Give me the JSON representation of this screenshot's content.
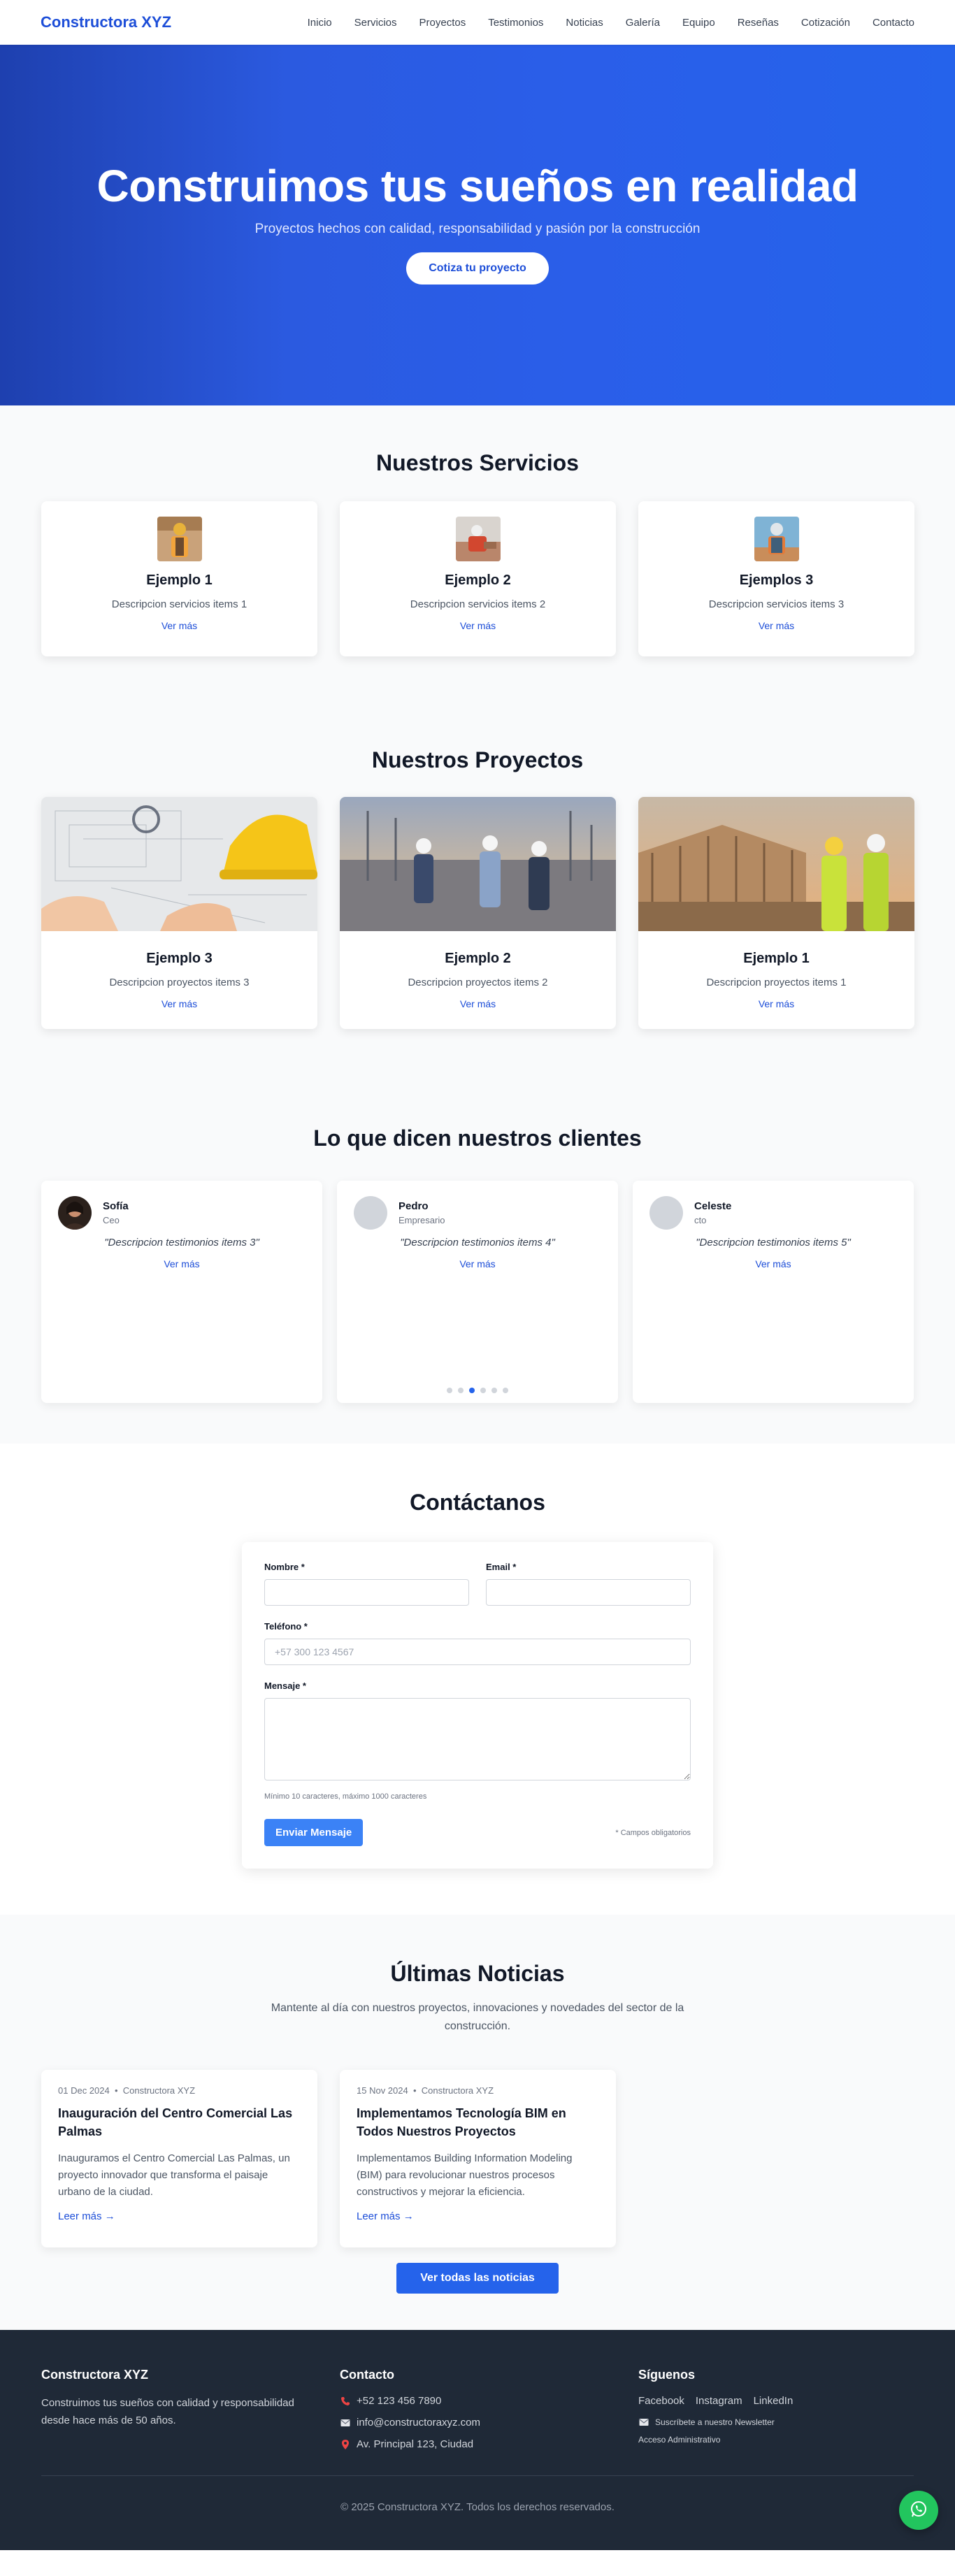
{
  "nav": {
    "brand": "Constructora XYZ",
    "links": [
      "Inicio",
      "Servicios",
      "Proyectos",
      "Testimonios",
      "Noticias",
      "Galería",
      "Equipo",
      "Reseñas",
      "Cotización",
      "Contacto"
    ]
  },
  "hero": {
    "title": "Construimos tus sueños en realidad",
    "subtitle": "Proyectos hechos con calidad, responsabilidad y pasión por la construcción",
    "cta": "Cotiza tu proyecto"
  },
  "services": {
    "title": "Nuestros Servicios",
    "items": [
      {
        "title": "Ejemplo 1",
        "desc": "Descripcion servicios items 1",
        "link": "Ver más"
      },
      {
        "title": "Ejemplo 2",
        "desc": "Descripcion servicios items 2",
        "link": "Ver más"
      },
      {
        "title": "Ejemplos 3",
        "desc": "Descripcion servicios items 3",
        "link": "Ver más"
      }
    ]
  },
  "projects": {
    "title": "Nuestros Proyectos",
    "items": [
      {
        "title": "Ejemplo 3",
        "desc": "Descripcion proyectos items 3",
        "link": "Ver más"
      },
      {
        "title": "Ejemplo 2",
        "desc": "Descripcion proyectos items 2",
        "link": "Ver más"
      },
      {
        "title": "Ejemplo 1",
        "desc": "Descripcion proyectos items 1",
        "link": "Ver más"
      }
    ]
  },
  "testimonials": {
    "title": "Lo que dicen nuestros clientes",
    "items": [
      {
        "name": "Sofía",
        "role": "Ceo",
        "quote": "\"Descripcion testimonios items 3\"",
        "link": "Ver más"
      },
      {
        "name": "Pedro",
        "role": "Empresario",
        "quote": "\"Descripcion testimonios items 4\"",
        "link": "Ver más"
      },
      {
        "name": "Celeste",
        "role": "cto",
        "quote": "\"Descripcion testimonios items 5\"",
        "link": "Ver más"
      }
    ],
    "active_dot": 2,
    "dot_count": 6
  },
  "contact": {
    "title": "Contáctanos",
    "name_label": "Nombre *",
    "email_label": "Email *",
    "phone_label": "Teléfono *",
    "phone_placeholder": "+57 300 123 4567",
    "message_label": "Mensaje *",
    "hint": "Mínimo 10 caracteres, máximo 1000 caracteres",
    "submit": "Enviar Mensaje",
    "required_note": "* Campos obligatorios"
  },
  "news": {
    "title": "Últimas Noticias",
    "subtitle": "Mantente al día con nuestros proyectos, innovaciones y novedades del sector de la construcción.",
    "items": [
      {
        "date": "01 Dec 2024",
        "source": "Constructora XYZ",
        "title": "Inauguración del Centro Comercial Las Palmas",
        "body": "Inauguramos el Centro Comercial Las Palmas, un proyecto innovador que transforma el paisaje urbano de la ciudad.",
        "link": "Leer más →"
      },
      {
        "date": "15 Nov 2024",
        "source": "Constructora XYZ",
        "title": "Implementamos Tecnología BIM en Todos Nuestros Proyectos",
        "body": "Implementamos Building Information Modeling (BIM) para revolucionar nuestros procesos constructivos y mejorar la eficiencia.",
        "link": "Leer más →"
      }
    ],
    "all_button": "Ver todas las noticias"
  },
  "footer": {
    "brand": "Constructora XYZ",
    "about": "Construimos tus sueños con calidad y responsabilidad desde hace más de 50 años.",
    "contact_title": "Contacto",
    "phone": "+52 123 456 7890",
    "email": "info@constructoraxyz.com",
    "address": "Av. Principal 123, Ciudad",
    "follow_title": "Síguenos",
    "social": [
      "Facebook",
      "Instagram",
      "LinkedIn"
    ],
    "newsletter": "Suscríbete a nuestro Newsletter",
    "admin": "Acceso Administrativo",
    "copyright": "© 2025 Constructora XYZ. Todos los derechos reservados."
  },
  "colors": {
    "primary": "#2563eb",
    "brand": "#1d4ed8",
    "footer_bg": "#1f2937",
    "whatsapp": "#22c55e"
  }
}
